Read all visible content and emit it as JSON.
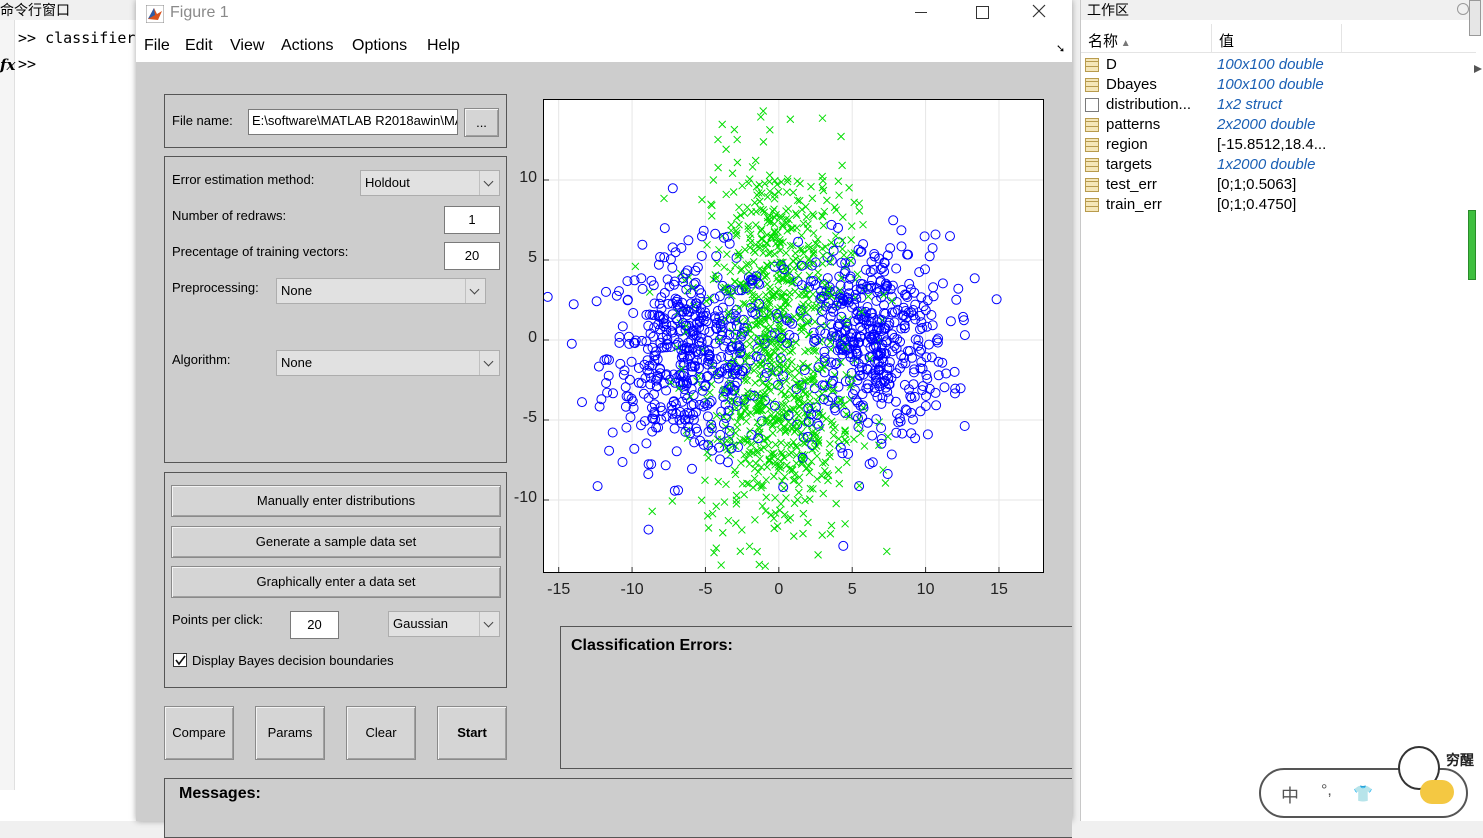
{
  "command_window": {
    "title": "命令行窗口",
    "lines": [
      ">> classifier",
      ">>"
    ],
    "fx_symbol": "fx"
  },
  "figure": {
    "title": "Figure 1",
    "menu": [
      "File",
      "Edit",
      "View",
      "Actions",
      "Options",
      "Help"
    ],
    "file_panel": {
      "label": "File name:",
      "value": "E:\\software\\MATLAB R2018awin\\MA",
      "browse": "..."
    },
    "settings": {
      "error_method_label": "Error estimation method:",
      "error_method_value": "Holdout",
      "redraws_label": "Number of redraws:",
      "redraws_value": "1",
      "training_label": "Precentage of training vectors:",
      "training_value": "20",
      "preprocessing_label": "Preprocessing:",
      "preprocessing_value": "None",
      "algorithm_label": "Algorithm:",
      "algorithm_value": "None"
    },
    "data_panel": {
      "manual": "Manually enter distributions",
      "generate": "Generate a sample data set",
      "graphical": "Graphically enter a data set",
      "points_label": "Points per click:",
      "points_value": "20",
      "dist_value": "Gaussian",
      "bayes_label": "Display Bayes decision boundaries",
      "bayes_checked": true
    },
    "buttons": {
      "compare": "Compare",
      "params": "Params",
      "clear": "Clear",
      "start": "Start"
    },
    "errors_title": "Classification Errors:",
    "messages_title": "Messages:"
  },
  "chart_data": {
    "type": "scatter",
    "xlim": [
      -16,
      18
    ],
    "ylim": [
      -14.5,
      15
    ],
    "xticks": [
      -15,
      -10,
      -5,
      0,
      5,
      10,
      15
    ],
    "yticks": [
      10,
      5,
      0,
      -5,
      -10
    ],
    "grid": true,
    "series": [
      {
        "marker": "o",
        "color": "#0000ff",
        "clusters": [
          {
            "cx": -6,
            "cy": -1,
            "sx": 2.8,
            "sy": 3.2,
            "n": 500
          },
          {
            "cx": 6,
            "cy": 0,
            "sx": 2.8,
            "sy": 3.2,
            "n": 500
          }
        ]
      },
      {
        "marker": "x",
        "color": "#00dd00",
        "clusters": [
          {
            "cx": 0,
            "cy": 4,
            "sx": 2.6,
            "sy": 3.8,
            "n": 500
          },
          {
            "cx": 0,
            "cy": -5,
            "sx": 2.6,
            "sy": 3.8,
            "n": 500
          }
        ]
      }
    ]
  },
  "workspace": {
    "title": "工作区",
    "col_name": "名称",
    "col_value": "值",
    "rows": [
      {
        "name": "D",
        "value": "100x100 double",
        "italic": true
      },
      {
        "name": "Dbayes",
        "value": "100x100 double",
        "italic": true
      },
      {
        "name": "distribution...",
        "value": "1x2 struct",
        "italic": true,
        "struct": true
      },
      {
        "name": "patterns",
        "value": "2x2000 double",
        "italic": true
      },
      {
        "name": "region",
        "value": "[-15.8512,18.4...",
        "italic": false
      },
      {
        "name": "targets",
        "value": "1x2000 double",
        "italic": true
      },
      {
        "name": "test_err",
        "value": "[0;1;0.5063]",
        "italic": false
      },
      {
        "name": "train_err",
        "value": "[0;1;0.4750]",
        "italic": false
      }
    ]
  },
  "ime": {
    "chars": [
      "中",
      "°,"
    ],
    "badge": "穷醒"
  }
}
